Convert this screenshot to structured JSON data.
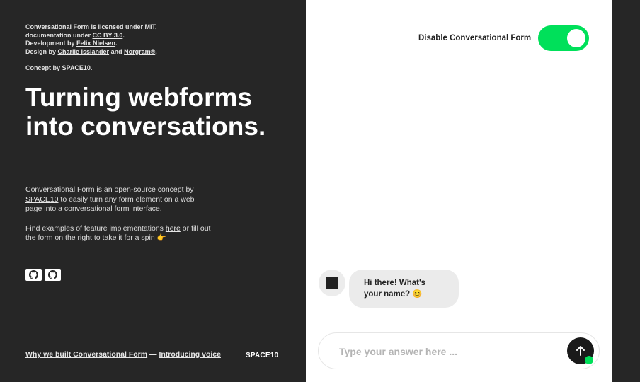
{
  "credits": {
    "line1_prefix": "Conversational Form is licensed under ",
    "license_link": "MIT",
    "line1_suffix": ",",
    "line2_prefix": "documentation under ",
    "docs_link": "CC BY 3.0",
    "line2_suffix": ".",
    "line3_prefix": "Development by ",
    "dev_link": "Felix Nielsen",
    "line3_suffix": ".",
    "line4_prefix": "Design by ",
    "design_link1": "Charlie Isslander",
    "line4_mid": " and ",
    "design_link2": "Norgram®",
    "line4_suffix": ".",
    "line5_prefix": "Concept by ",
    "concept_link": "SPACE10",
    "line5_suffix": "."
  },
  "headline": "Turning webforms into conversations.",
  "description": {
    "p1_link": "SPACE10",
    "p1_prefix": "Conversational Form is an open-source concept by ",
    "p1_suffix": " to easily turn any form element on a web page into a conversational form interface.",
    "p2_prefix": "Find examples of feature implementations ",
    "p2_link": "here",
    "p2_suffix": " or fill out the form on the right to take it for a spin 👉"
  },
  "github_icons": [
    "github-icon",
    "github-icon"
  ],
  "footer": {
    "link1": "Why we built Conversational Form",
    "separator": " — ",
    "link2": "Introducing voice",
    "logo": "SPACE10"
  },
  "toggle": {
    "label": "Disable Conversational Form",
    "on": true,
    "color": "#00e05a"
  },
  "chat": {
    "bot_message": "Hi there! What's your name? 😊",
    "input_placeholder": "Type your answer here ...",
    "input_value": "",
    "send_icon": "arrow-up-icon"
  }
}
